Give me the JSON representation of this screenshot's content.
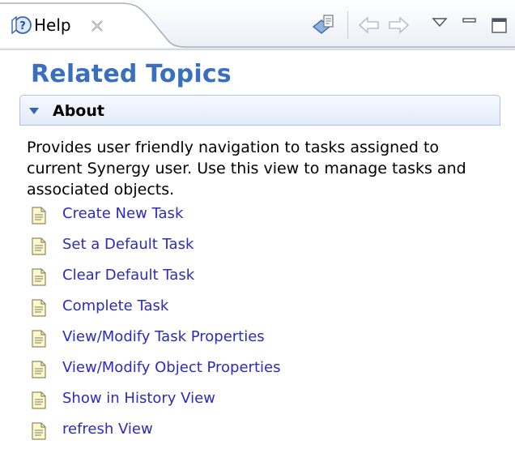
{
  "tab": {
    "label": "Help",
    "icon": "help-question-icon",
    "close_icon": "close-icon"
  },
  "toolbar": {
    "buttons": [
      {
        "name": "show-in-external-window-icon"
      },
      {
        "name": "back-arrow-icon"
      },
      {
        "name": "forward-arrow-icon"
      },
      {
        "name": "view-menu-icon"
      },
      {
        "name": "minimize-icon"
      },
      {
        "name": "maximize-icon"
      }
    ]
  },
  "content": {
    "title": "Related Topics",
    "section": {
      "title": "About",
      "toggle_icon": "triangle-down-icon",
      "description": "Provides user friendly navigation to tasks assigned to current Synergy user. Use this view to manage tasks and associated objects."
    },
    "links": [
      {
        "label": "Create New Task",
        "icon": "document-icon"
      },
      {
        "label": "Set a Default Task",
        "icon": "document-icon"
      },
      {
        "label": "Clear Default Task",
        "icon": "document-icon"
      },
      {
        "label": "Complete Task",
        "icon": "document-icon"
      },
      {
        "label": "View/Modify Task Properties",
        "icon": "document-icon"
      },
      {
        "label": "View/Modify Object Properties",
        "icon": "document-icon"
      },
      {
        "label": "Show in History View",
        "icon": "document-icon"
      },
      {
        "label": "refresh View",
        "icon": "document-icon"
      }
    ]
  },
  "colors": {
    "title": "#3a6fbf",
    "link": "#2b2bbf",
    "section_border": "#a9c4e8"
  }
}
